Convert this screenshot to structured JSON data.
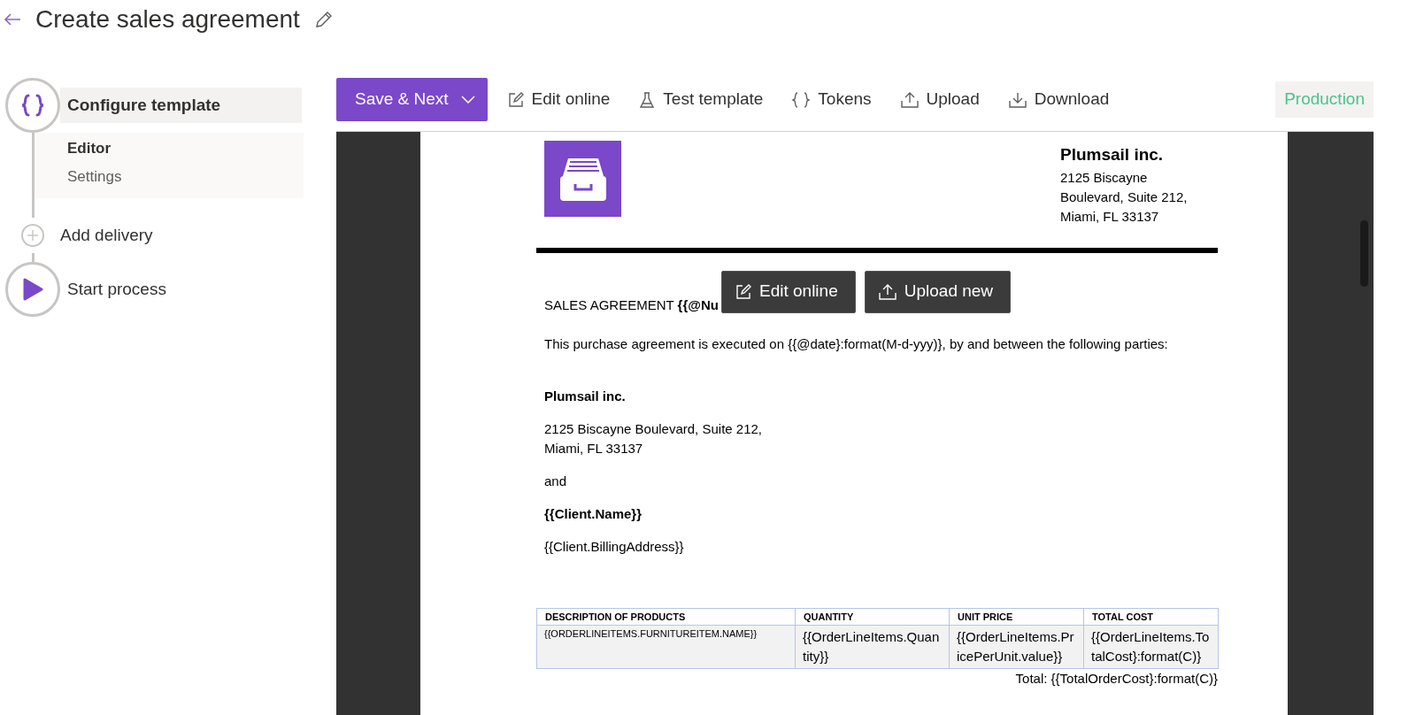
{
  "page": {
    "title": "Create sales agreement"
  },
  "steps": [
    {
      "kind": "template",
      "label": "Configure template",
      "selected": true,
      "children": [
        {
          "label": "Editor",
          "selected": true
        },
        {
          "label": "Settings",
          "selected": false
        }
      ]
    },
    {
      "kind": "add",
      "label": "Add delivery",
      "selected": false
    },
    {
      "kind": "start",
      "label": "Start process",
      "selected": false
    }
  ],
  "toolbar": {
    "primary": "Save & Next",
    "actions": [
      {
        "kind": "edit",
        "label": "Edit online"
      },
      {
        "kind": "test",
        "label": "Test template"
      },
      {
        "kind": "tokens",
        "label": "Tokens"
      },
      {
        "kind": "upload",
        "label": "Upload"
      },
      {
        "kind": "download",
        "label": "Download"
      }
    ],
    "environment": "Production"
  },
  "document": {
    "company": {
      "name": "Plumsail inc.",
      "address": "2125 Biscayne\nBoulevard, Suite 212,\nMiami, FL 33137"
    },
    "heading": "SALES AGREEMENT **{{@Nu**",
    "overlay_buttons": [
      {
        "kind": "edit",
        "label": "Edit online"
      },
      {
        "kind": "upload",
        "label": "Upload new"
      }
    ],
    "paragraphs": [
      {
        "text": "This purchase agreement is executed on {{@date}:format(M-d-yyy)}, by and between the following parties:",
        "bold": false
      },
      {
        "text": "Plumsail inc.",
        "bold": true
      },
      {
        "text": "2125 Biscayne Boulevard, Suite 212,\nMiami, FL 33137",
        "bold": false
      },
      {
        "text": "and",
        "bold": false
      },
      {
        "text": "{{Client.Name}}",
        "bold": true
      },
      {
        "text": "{{Client.BillingAddress}}",
        "bold": false
      }
    ],
    "table": {
      "columns": [
        "DESCRIPTION OF PRODUCTS",
        "QUANTITY",
        "UNIT PRICE",
        "TOTAL COST"
      ],
      "rows": [
        [
          "{{ORDERLINEITEMS.FURNITUREITEM.NAME}}",
          "{{OrderLineItems.Quantity}}",
          "{{OrderLineItems.PricePerUnit.value}}",
          "{{OrderLineItems.TotalCost}:format(C)}"
        ]
      ]
    },
    "total": "Total: {{TotalOrderCost}:format(C)}"
  }
}
